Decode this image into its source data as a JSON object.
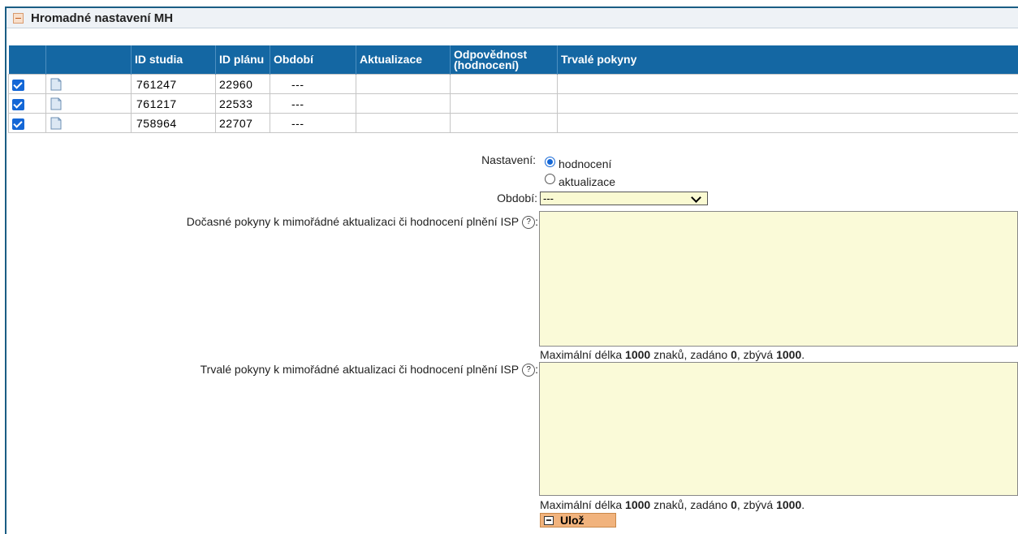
{
  "panel": {
    "title": "Hromadné nastavení MH"
  },
  "table": {
    "headers": [
      "",
      "",
      "ID studia",
      "ID plánu",
      "Období",
      "Aktualizace",
      "Odpovědnost (hodnocení)",
      "Trvalé pokyny"
    ],
    "rows": [
      {
        "selected": true,
        "id_studia": "761247",
        "id_planu": "22960",
        "obdobi": "---",
        "aktualizace": "",
        "odpovednost": "",
        "trvale": ""
      },
      {
        "selected": true,
        "id_studia": "761217",
        "id_planu": "22533",
        "obdobi": "---",
        "aktualizace": "",
        "odpovednost": "",
        "trvale": ""
      },
      {
        "selected": true,
        "id_studia": "758964",
        "id_planu": "22707",
        "obdobi": "---",
        "aktualizace": "",
        "odpovednost": "",
        "trvale": ""
      }
    ]
  },
  "form": {
    "nastaveni_label": "Nastavení:",
    "option_hodnoceni": "hodnocení",
    "option_aktualizace": "aktualizace",
    "obdobi_label": "Období:",
    "obdobi_value": "---",
    "docasne_label": "Dočasné pokyny k mimořádné aktualizaci či hodnocení plnění ISP",
    "trvale_label": "Trvalé pokyny k mimořádné aktualizaci či hodnocení plnění ISP",
    "help_glyph": "?",
    "label_colon": ":",
    "counter": {
      "prefix": "Maximální délka ",
      "max": "1000",
      "mid1": " znaků, zadáno ",
      "entered": "0",
      "mid2": ", zbývá ",
      "remaining": "1000",
      "suffix": "."
    },
    "save_label": "Ulož"
  },
  "colors": {
    "header_bg": "#1467a3",
    "textarea_bg": "#fafad8",
    "accent": "#1467d6",
    "button_bg": "#f1b37d"
  },
  "icons": {
    "row_icon": "document-icon",
    "checkbox": "checkbox-checked-icon",
    "help": "help-icon",
    "save": "save-icon",
    "collapse": "collapse-icon"
  }
}
